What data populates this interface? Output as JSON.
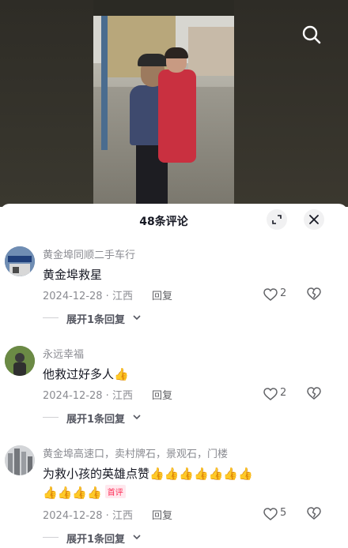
{
  "header": {
    "title": "48条评论"
  },
  "comments": [
    {
      "username": "黄金埠同顺二手车行",
      "text": "黄金埠救星",
      "emoji_line": [],
      "date_location": "2024-12-28 · 江西",
      "reply_label": "回复",
      "likes": "2",
      "expand_label": "展开1条回复"
    },
    {
      "username": "永远幸福",
      "text": "他救过好多人",
      "emoji_line": [],
      "date_location": "2024-12-28 · 江西",
      "reply_label": "回复",
      "likes": "2",
      "expand_label": "展开1条回复"
    },
    {
      "username": "黄金埠高速口，卖村牌石，景观石，门楼",
      "text": "为救小孩的英雄点赞",
      "first_badge": "首评",
      "date_location": "2024-12-28 · 江西",
      "reply_label": "回复",
      "likes": "5",
      "expand_label": "展开1条回复"
    }
  ],
  "icons": {
    "search": "search-icon",
    "expand": "expand-icon",
    "close": "close-icon",
    "like": "heart-outline-icon",
    "dislike": "broken-heart-icon",
    "thumbs_up": "thumbs-up-emoji",
    "chevron": "chevron-down-icon"
  },
  "colors": {
    "accent": "#fe2c55",
    "meta_text": "#8a8b91",
    "primary_text": "#161823",
    "emoji": "#f5b400"
  }
}
